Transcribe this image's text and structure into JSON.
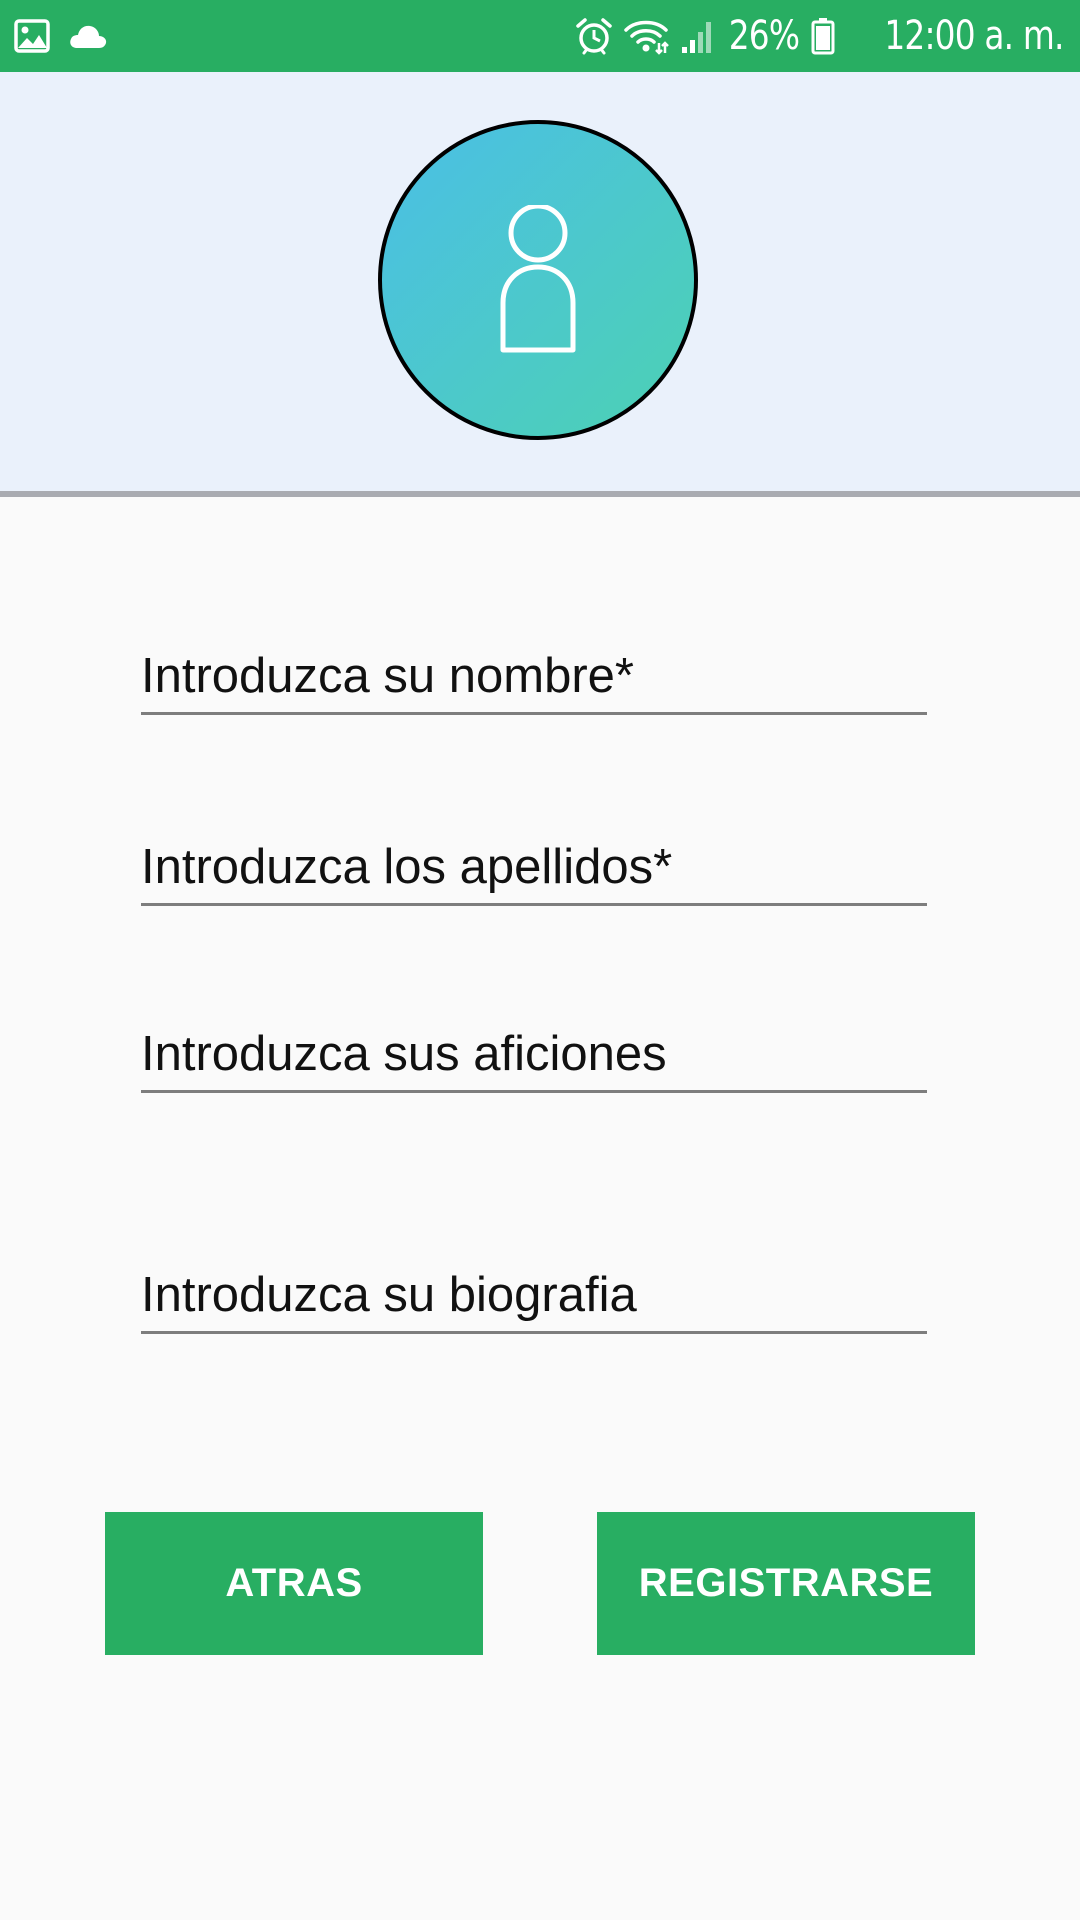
{
  "status_bar": {
    "battery": "26%",
    "time": "12:00 a. m.",
    "icons": [
      "gallery-icon",
      "cloud-icon",
      "alarm-icon",
      "wifi-icon",
      "signal-icon",
      "battery-icon"
    ],
    "color": "#28ae62"
  },
  "header": {
    "background": "#eaf1fb",
    "avatar_icon": "person-icon"
  },
  "form": {
    "fields": [
      {
        "placeholder": "Introduzca su nombre*",
        "value": ""
      },
      {
        "placeholder": "Introduzca los apellidos*",
        "value": ""
      },
      {
        "placeholder": "Introduzca sus aficiones",
        "value": ""
      },
      {
        "placeholder": "Introduzca su biografia",
        "value": ""
      }
    ]
  },
  "buttons": {
    "back_label": "ATRAS",
    "register_label": "REGISTRARSE",
    "color": "#28ae62"
  }
}
